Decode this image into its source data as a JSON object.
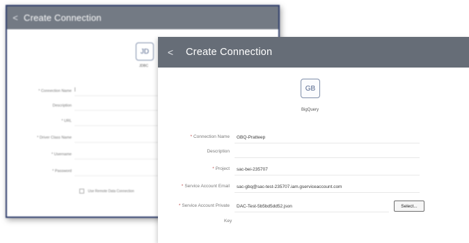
{
  "back_dialog": {
    "title": "Create Connection",
    "back_glyph": "<",
    "icon_text": "JD",
    "type_label": "JDBC",
    "fields": [
      {
        "label": "* Connection Name",
        "value": "|"
      },
      {
        "label": "Description",
        "value": ""
      },
      {
        "label": "* URL",
        "value": ""
      },
      {
        "label": "* Driver Class Name",
        "value": ""
      },
      {
        "label": "* Username",
        "value": ""
      },
      {
        "label": "* Password",
        "value": ""
      }
    ],
    "checkbox_label": "Use Remote Data Connection"
  },
  "front_dialog": {
    "title": "Create Connection",
    "back_glyph": "<",
    "icon_text": "GB",
    "type_label": "BigQuery",
    "fields": [
      {
        "label": "Connection Name",
        "required": true,
        "value": "GBQ-Pratteep"
      },
      {
        "label": "Description",
        "required": false,
        "value": ""
      },
      {
        "label": "Project",
        "required": true,
        "value": "sac-bei-235707"
      },
      {
        "label": "Service Account Email",
        "required": true,
        "value": "sac-gbq@sac-test-235707.iam.gserviceaccount.com"
      },
      {
        "label": "Service Account Private",
        "required": true,
        "value": "DAC-Test-5b5bd5dd52.json"
      }
    ],
    "private_key_label_line2": "Key",
    "select_button_label": "Select..."
  }
}
